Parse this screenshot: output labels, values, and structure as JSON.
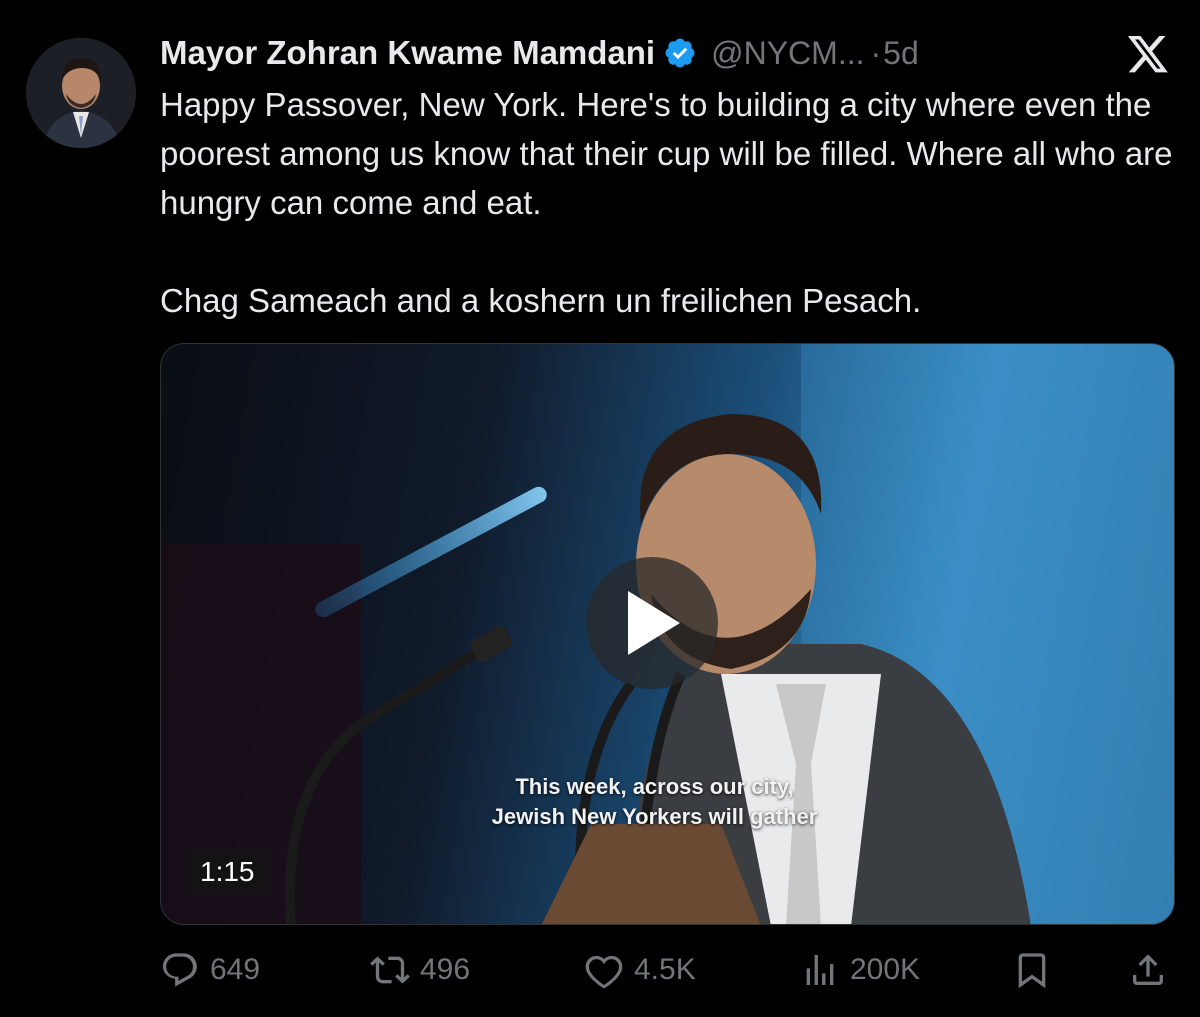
{
  "author": {
    "name": "Mayor Zohran Kwame Mamdani",
    "handle": "@NYCM...",
    "separator": "·",
    "time": "5d",
    "verified_color": "#1d9bf0"
  },
  "tweet": {
    "paragraph_1": "Happy Passover, New York. Here's to building a city where even the poorest among us know that their cup will be filled. Where all who are hungry can come and eat.",
    "paragraph_2": "Chag Sameach and a koshern un freilichen Pesach."
  },
  "media": {
    "subtitle_line_1": "This week, across our city,",
    "subtitle_line_2": "Jewish New Yorkers will gather",
    "duration": "1:15"
  },
  "actions": {
    "replies": "649",
    "reposts": "496",
    "likes": "4.5K",
    "views": "200K"
  },
  "icons": {
    "reply": "reply-icon",
    "repost": "repost-icon",
    "like": "heart-icon",
    "views": "views-icon",
    "bookmark": "bookmark-icon",
    "share": "share-icon",
    "platform": "x-logo-icon"
  },
  "colors": {
    "background": "#000000",
    "text": "#e7e9ea",
    "muted": "#71767b"
  }
}
